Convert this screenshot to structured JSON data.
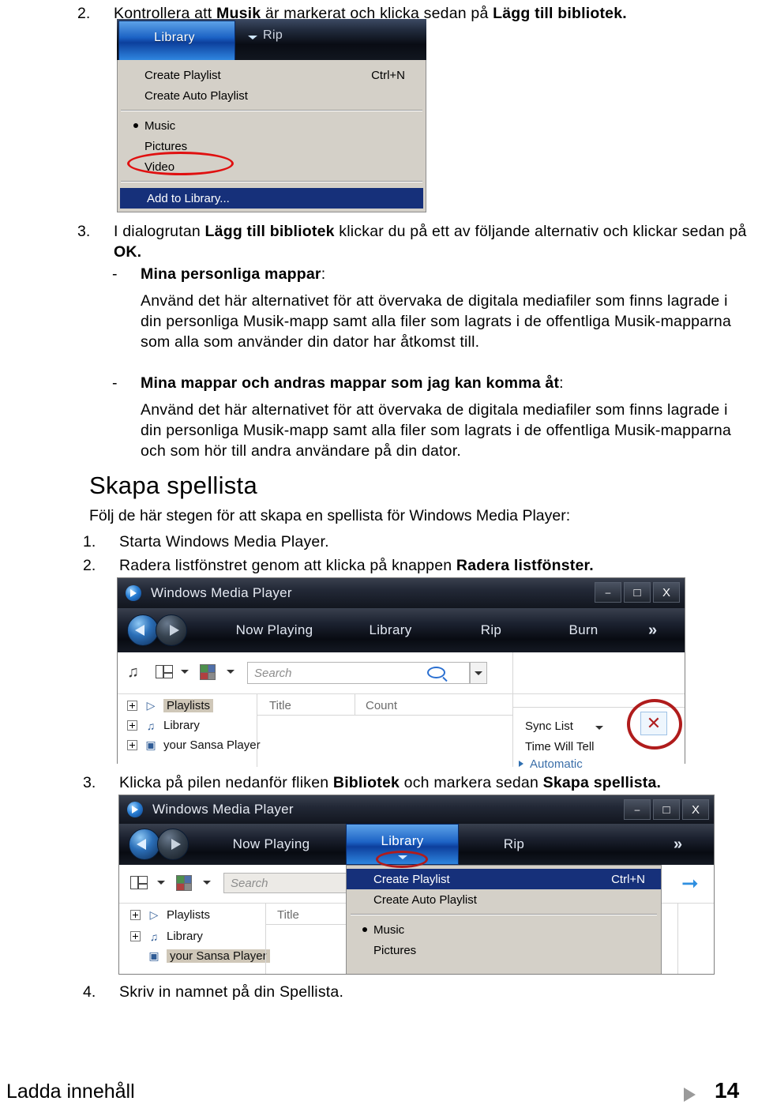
{
  "document": {
    "steps": [
      {
        "number": "2.",
        "text_parts": [
          {
            "t": "Kontrollera att ",
            "b": false
          },
          {
            "t": "Musik",
            "b": true
          },
          {
            "t": " är markerat och klicka sedan på ",
            "b": false
          },
          {
            "t": "Lägg till bibliotek.",
            "b": true
          }
        ]
      }
    ],
    "step2_num": "2.",
    "step2_a": "Kontrollera att ",
    "step2_b1": "Musik",
    "step2_c": " är markerat och klicka sedan på ",
    "step2_b2": "Lägg till bibliotek.",
    "step3_num": "3.",
    "step3_a": "I dialogrutan ",
    "step3_b1": "Lägg till bibliotek",
    "step3_c": " klickar du på ett av följande alternativ och klickar sedan på ",
    "step3_b2": "OK.",
    "bullet1_dash": "-",
    "bullet1_title": "Mina personliga mappar",
    "bullet1_colon": ":",
    "bullet1_body": "Använd det här alternativet för att övervaka de digitala mediafiler som finns lagrade i din personliga Musik-mapp samt alla filer som lagrats i de offentliga Musik-mapparna som alla som använder din dator har åtkomst till.",
    "bullet2_dash": "-",
    "bullet2_title": "Mina mappar och andras mappar som jag kan komma åt",
    "bullet2_colon": ":",
    "bullet2_body": "Använd det här alternativet för att övervaka de digitala mediafiler som finns lagrade i din personliga Musik-mapp samt alla filer som lagrats i de offentliga Musik-mapparna och som hör till andra användare på din dator.",
    "heading_skapa": "Skapa spellista",
    "intro_skapa": "Följ de här stegen för att skapa en spellista för Windows Media Player:",
    "step_s1_num": "1.",
    "step_s1_text": "Starta Windows Media Player.",
    "step_s2_num": "2.",
    "step_s2_a": "Radera listfönstret genom att klicka på knappen ",
    "step_s2_b": "Radera listfönster.",
    "step_s3_num": "3.",
    "step_s3_a": "Klicka på pilen nedanför fliken ",
    "step_s3_b1": "Bibliotek",
    "step_s3_c": " och markera sedan ",
    "step_s3_b2": "Skapa spellista.",
    "step_s4_num": "4.",
    "step_s4_text": "Skriv in namnet på din Spellista."
  },
  "footer": {
    "title": "Ladda innehåll",
    "page_number": "14",
    "marker_icon": "triangle-right-icon"
  },
  "screenshot1": {
    "tab_library": "Library",
    "tab_rip": "Rip",
    "menu": {
      "create_playlist": "Create Playlist",
      "create_playlist_accel": "Ctrl+N",
      "create_auto_playlist": "Create Auto Playlist",
      "music": "Music",
      "pictures": "Pictures",
      "video": "Video",
      "add_to_library": "Add to Library..."
    },
    "annotation_color": "#e01010"
  },
  "screenshot2": {
    "window_title": "Windows Media Player",
    "window_buttons": {
      "minimize": "–",
      "maximize": "□",
      "close": "X"
    },
    "tabs": [
      "Now Playing",
      "Library",
      "Rip",
      "Burn"
    ],
    "tab_now_playing": "Now Playing",
    "tab_library": "Library",
    "tab_rip": "Rip",
    "tab_burn": "Burn",
    "chevron": "»",
    "search_placeholder": "Search",
    "tree": [
      {
        "label": "Playlists",
        "icon": "playlist-icon",
        "highlighted": true
      },
      {
        "label": "Library",
        "icon": "music-note-icon",
        "highlighted": false
      },
      {
        "label": "your Sansa Player",
        "icon": "device-icon",
        "highlighted": false
      }
    ],
    "tree_playlists": "Playlists",
    "tree_library": "Library",
    "tree_sansa": "your Sansa Player",
    "column_title": "Title",
    "column_count": "Count",
    "sync_list": "Sync List",
    "sync_item": "Time Will Tell",
    "sync_automatic": "Automatic",
    "clear_button_glyph": "✕",
    "annotation_color": "#b01c1c"
  },
  "screenshot3": {
    "window_title": "Windows Media Player",
    "window_buttons": {
      "minimize": "–",
      "maximize": "□",
      "close": "X"
    },
    "tab_now_playing": "Now Playing",
    "tab_library": "Library",
    "tab_rip": "Rip",
    "chevron": "»",
    "search_placeholder": "Search",
    "tree_playlists": "Playlists",
    "tree_library": "Library",
    "tree_sansa": "your Sansa Player",
    "column_title": "Title",
    "menu": {
      "create_playlist": "Create Playlist",
      "create_playlist_accel": "Ctrl+N",
      "create_auto_playlist": "Create Auto Playlist",
      "music": "Music",
      "pictures": "Pictures"
    },
    "annotation_color": "#b01c1c",
    "arrow_icon": "arrow-right-icon"
  }
}
